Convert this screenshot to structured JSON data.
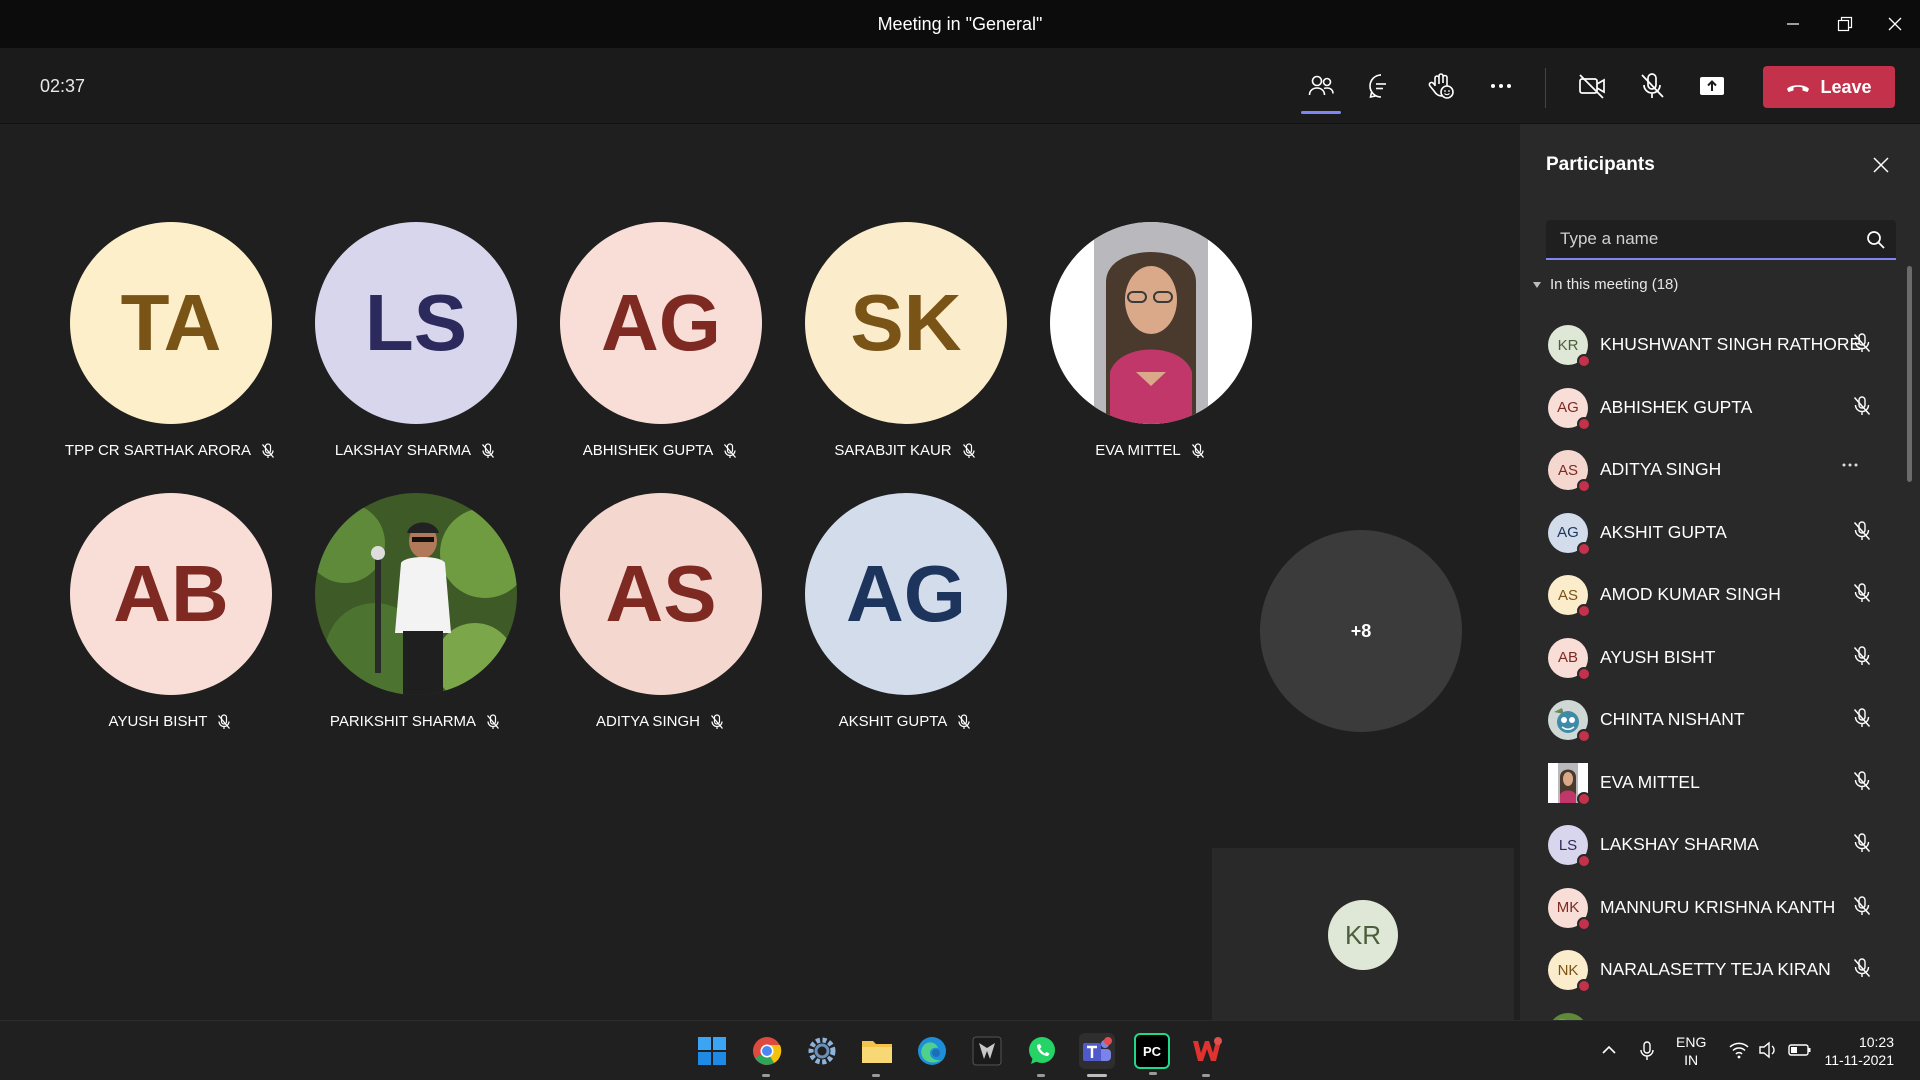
{
  "window": {
    "title": "Meeting in \"General\""
  },
  "toolbar": {
    "timer": "02:37",
    "leave_label": "Leave",
    "accent": "#7f85f5",
    "leave_color": "#c4314b"
  },
  "stage": {
    "tiles": [
      {
        "initials": "TA",
        "name": "TPP CR SARTHAK ARORA",
        "bg": "#fcefc9",
        "fg": "#7a5416"
      },
      {
        "initials": "LS",
        "name": "LAKSHAY SHARMA",
        "bg": "#d8d6ec",
        "fg": "#2c2a5c"
      },
      {
        "initials": "AG",
        "name": "ABHISHEK GUPTA",
        "bg": "#f8ded7",
        "fg": "#7e2a22"
      },
      {
        "initials": "SK",
        "name": "SARABJIT KAUR",
        "bg": "#fbeccb",
        "fg": "#7a5416"
      },
      {
        "initials": "",
        "name": "EVA MITTEL",
        "bg": "photo",
        "fg": ""
      },
      {
        "initials": "AB",
        "name": "AYUSH BISHT",
        "bg": "#f8ded7",
        "fg": "#7e2a22"
      },
      {
        "initials": "",
        "name": "PARIKSHIT SHARMA",
        "bg": "photo",
        "fg": ""
      },
      {
        "initials": "AS",
        "name": "ADITYA SINGH",
        "bg": "#f4d8d0",
        "fg": "#7e2a22"
      },
      {
        "initials": "AG",
        "name": "AKSHIT GUPTA",
        "bg": "#d2dceb",
        "fg": "#1d355c"
      }
    ],
    "overflow_label": "+8",
    "self_initials": "KR"
  },
  "panel": {
    "title": "Participants",
    "search_placeholder": "Type a name",
    "section_label": "In this meeting (18)",
    "participants": [
      {
        "initials": "KR",
        "name": "KHUSHWANT SINGH RATHORE",
        "bg": "#dfe8d6",
        "fg": "#4c5e3c",
        "action": "mic-off"
      },
      {
        "initials": "AG",
        "name": "ABHISHEK GUPTA",
        "bg": "#f8ded7",
        "fg": "#7e2a22",
        "action": "mic-off"
      },
      {
        "initials": "AS",
        "name": "ADITYA SINGH",
        "bg": "#f4d8d0",
        "fg": "#7e2a22",
        "action": "more"
      },
      {
        "initials": "AG",
        "name": "AKSHIT GUPTA",
        "bg": "#d2dceb",
        "fg": "#1d355c",
        "action": "mic-off"
      },
      {
        "initials": "AS",
        "name": "AMOD KUMAR SINGH",
        "bg": "#fbeccb",
        "fg": "#7a5416",
        "action": "mic-off"
      },
      {
        "initials": "AB",
        "name": "AYUSH BISHT",
        "bg": "#f8ded7",
        "fg": "#7e2a22",
        "action": "mic-off"
      },
      {
        "initials": "",
        "name": "CHINTA NISHANT",
        "bg": "photo",
        "fg": "",
        "action": "mic-off"
      },
      {
        "initials": "",
        "name": "EVA MITTEL",
        "bg": "photo",
        "fg": "",
        "action": "mic-off"
      },
      {
        "initials": "LS",
        "name": "LAKSHAY SHARMA",
        "bg": "#d8d6ec",
        "fg": "#2c2a5c",
        "action": "mic-off"
      },
      {
        "initials": "MK",
        "name": "MANNURU KRISHNA KANTH",
        "bg": "#f8ded7",
        "fg": "#7e2a22",
        "action": "mic-off"
      },
      {
        "initials": "NK",
        "name": "NARALASETTY TEJA KIRAN",
        "bg": "#fbeccb",
        "fg": "#7a5416",
        "action": "mic-off"
      },
      {
        "initials": "",
        "name": "",
        "bg": "photo",
        "fg": "",
        "action": "mic-off"
      }
    ]
  },
  "taskbar": {
    "apps": [
      "start-icon",
      "chrome-icon",
      "settings-icon",
      "file-explorer-icon",
      "edge-icon",
      "game-icon",
      "whatsapp-icon",
      "teams-icon",
      "pycharm-icon",
      "wps-office-icon"
    ],
    "pycharm_label": "PC",
    "lang_line1": "ENG",
    "lang_line2": "IN",
    "time": "10:23",
    "date": "11-11-2021"
  }
}
